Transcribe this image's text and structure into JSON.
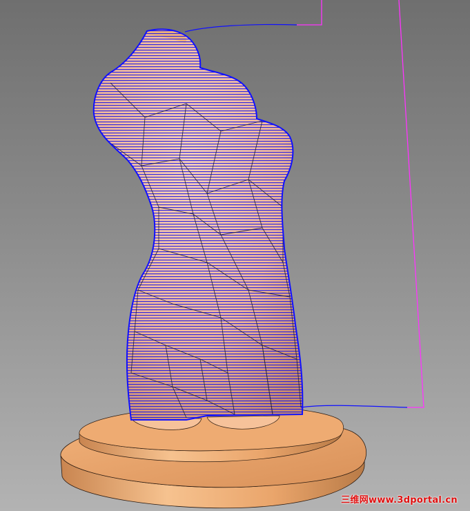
{
  "watermark": {
    "text": "三维网www.3dportal.cn"
  },
  "colors": {
    "background_top": "#6f6f6f",
    "background_bottom": "#b3b3b3",
    "model": "#e8a56e",
    "model_highlight": "#fbd3a8",
    "model_shadow": "#b87a46",
    "toolpath": "#1010ff",
    "retract_path": "#ff33ff",
    "edge_lines": "#202020",
    "watermark": "#e01010"
  },
  "icons": [
    "torso-model",
    "pedestal-base",
    "toolpath-lines",
    "retract-path"
  ]
}
